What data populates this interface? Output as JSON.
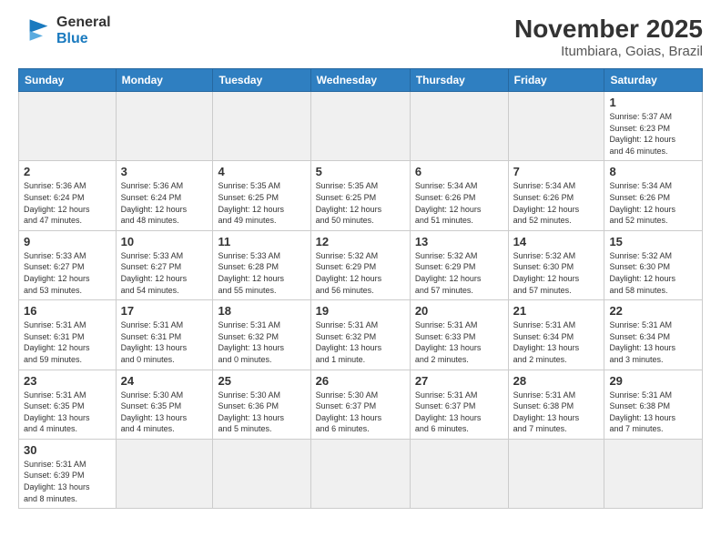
{
  "logo": {
    "line1": "General",
    "line2": "Blue"
  },
  "title": "November 2025",
  "subtitle": "Itumbiara, Goias, Brazil",
  "weekdays": [
    "Sunday",
    "Monday",
    "Tuesday",
    "Wednesday",
    "Thursday",
    "Friday",
    "Saturday"
  ],
  "weeks": [
    [
      {
        "day": "",
        "info": ""
      },
      {
        "day": "",
        "info": ""
      },
      {
        "day": "",
        "info": ""
      },
      {
        "day": "",
        "info": ""
      },
      {
        "day": "",
        "info": ""
      },
      {
        "day": "",
        "info": ""
      },
      {
        "day": "1",
        "info": "Sunrise: 5:37 AM\nSunset: 6:23 PM\nDaylight: 12 hours\nand 46 minutes."
      }
    ],
    [
      {
        "day": "2",
        "info": "Sunrise: 5:36 AM\nSunset: 6:24 PM\nDaylight: 12 hours\nand 47 minutes."
      },
      {
        "day": "3",
        "info": "Sunrise: 5:36 AM\nSunset: 6:24 PM\nDaylight: 12 hours\nand 48 minutes."
      },
      {
        "day": "4",
        "info": "Sunrise: 5:35 AM\nSunset: 6:25 PM\nDaylight: 12 hours\nand 49 minutes."
      },
      {
        "day": "5",
        "info": "Sunrise: 5:35 AM\nSunset: 6:25 PM\nDaylight: 12 hours\nand 50 minutes."
      },
      {
        "day": "6",
        "info": "Sunrise: 5:34 AM\nSunset: 6:26 PM\nDaylight: 12 hours\nand 51 minutes."
      },
      {
        "day": "7",
        "info": "Sunrise: 5:34 AM\nSunset: 6:26 PM\nDaylight: 12 hours\nand 52 minutes."
      },
      {
        "day": "8",
        "info": "Sunrise: 5:34 AM\nSunset: 6:26 PM\nDaylight: 12 hours\nand 52 minutes."
      }
    ],
    [
      {
        "day": "9",
        "info": "Sunrise: 5:33 AM\nSunset: 6:27 PM\nDaylight: 12 hours\nand 53 minutes."
      },
      {
        "day": "10",
        "info": "Sunrise: 5:33 AM\nSunset: 6:27 PM\nDaylight: 12 hours\nand 54 minutes."
      },
      {
        "day": "11",
        "info": "Sunrise: 5:33 AM\nSunset: 6:28 PM\nDaylight: 12 hours\nand 55 minutes."
      },
      {
        "day": "12",
        "info": "Sunrise: 5:32 AM\nSunset: 6:29 PM\nDaylight: 12 hours\nand 56 minutes."
      },
      {
        "day": "13",
        "info": "Sunrise: 5:32 AM\nSunset: 6:29 PM\nDaylight: 12 hours\nand 57 minutes."
      },
      {
        "day": "14",
        "info": "Sunrise: 5:32 AM\nSunset: 6:30 PM\nDaylight: 12 hours\nand 57 minutes."
      },
      {
        "day": "15",
        "info": "Sunrise: 5:32 AM\nSunset: 6:30 PM\nDaylight: 12 hours\nand 58 minutes."
      }
    ],
    [
      {
        "day": "16",
        "info": "Sunrise: 5:31 AM\nSunset: 6:31 PM\nDaylight: 12 hours\nand 59 minutes."
      },
      {
        "day": "17",
        "info": "Sunrise: 5:31 AM\nSunset: 6:31 PM\nDaylight: 13 hours\nand 0 minutes."
      },
      {
        "day": "18",
        "info": "Sunrise: 5:31 AM\nSunset: 6:32 PM\nDaylight: 13 hours\nand 0 minutes."
      },
      {
        "day": "19",
        "info": "Sunrise: 5:31 AM\nSunset: 6:32 PM\nDaylight: 13 hours\nand 1 minute."
      },
      {
        "day": "20",
        "info": "Sunrise: 5:31 AM\nSunset: 6:33 PM\nDaylight: 13 hours\nand 2 minutes."
      },
      {
        "day": "21",
        "info": "Sunrise: 5:31 AM\nSunset: 6:34 PM\nDaylight: 13 hours\nand 2 minutes."
      },
      {
        "day": "22",
        "info": "Sunrise: 5:31 AM\nSunset: 6:34 PM\nDaylight: 13 hours\nand 3 minutes."
      }
    ],
    [
      {
        "day": "23",
        "info": "Sunrise: 5:31 AM\nSunset: 6:35 PM\nDaylight: 13 hours\nand 4 minutes."
      },
      {
        "day": "24",
        "info": "Sunrise: 5:30 AM\nSunset: 6:35 PM\nDaylight: 13 hours\nand 4 minutes."
      },
      {
        "day": "25",
        "info": "Sunrise: 5:30 AM\nSunset: 6:36 PM\nDaylight: 13 hours\nand 5 minutes."
      },
      {
        "day": "26",
        "info": "Sunrise: 5:30 AM\nSunset: 6:37 PM\nDaylight: 13 hours\nand 6 minutes."
      },
      {
        "day": "27",
        "info": "Sunrise: 5:31 AM\nSunset: 6:37 PM\nDaylight: 13 hours\nand 6 minutes."
      },
      {
        "day": "28",
        "info": "Sunrise: 5:31 AM\nSunset: 6:38 PM\nDaylight: 13 hours\nand 7 minutes."
      },
      {
        "day": "29",
        "info": "Sunrise: 5:31 AM\nSunset: 6:38 PM\nDaylight: 13 hours\nand 7 minutes."
      }
    ],
    [
      {
        "day": "30",
        "info": "Sunrise: 5:31 AM\nSunset: 6:39 PM\nDaylight: 13 hours\nand 8 minutes."
      },
      {
        "day": "",
        "info": ""
      },
      {
        "day": "",
        "info": ""
      },
      {
        "day": "",
        "info": ""
      },
      {
        "day": "",
        "info": ""
      },
      {
        "day": "",
        "info": ""
      },
      {
        "day": "",
        "info": ""
      }
    ]
  ]
}
